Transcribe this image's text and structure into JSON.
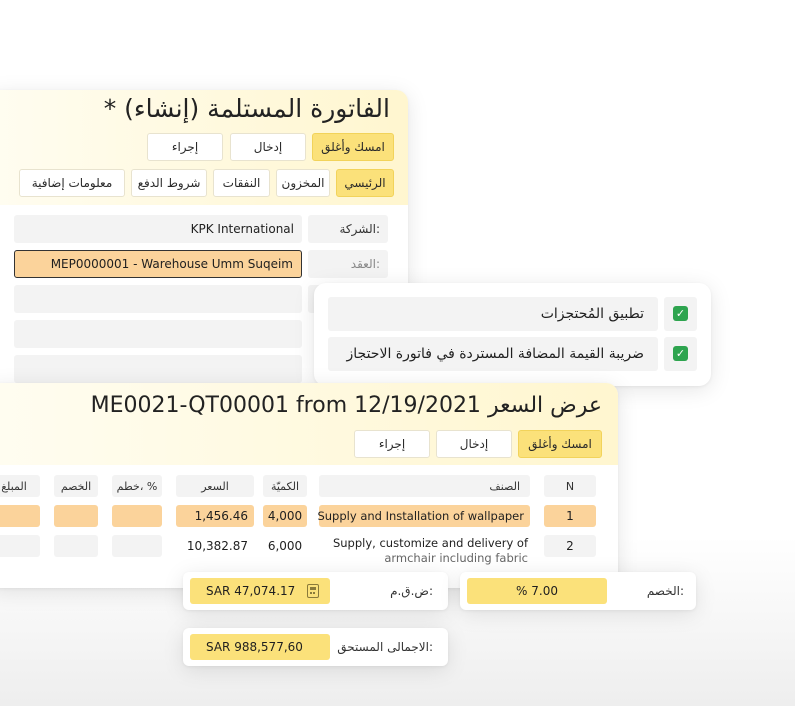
{
  "invoice": {
    "title": "الفاتورة المستلمة (إنشاء) *",
    "buttons": {
      "save_close": "امسك وأغلق",
      "enter": "إدخال",
      "action": "إجراء"
    },
    "tabs": [
      "الرئيسي",
      "المخزون",
      "النفقات",
      "شروط الدفع",
      "معلومات إضافية"
    ],
    "company_label": "الشركة:",
    "company_value": "KPK International",
    "contract_label": "العقد:",
    "contract_value": "MEP0000001 - Warehouse Umm Suqeim"
  },
  "options": {
    "items": [
      "تطبيق المُحتجزات",
      "ضريبة القيمة المضافة المستردة في فاتورة الاحتجاز"
    ]
  },
  "quote": {
    "title": "ME0021-QT00001 from 12/19/2021 عرض السعر",
    "buttons": {
      "save_close": "امسك وأغلق",
      "enter": "إدخال",
      "action": "إجراء"
    },
    "columns": {
      "n": "N",
      "item": "الصنف",
      "qty": "الكميّة",
      "price": "السعر",
      "disc_pct": "خطم، %",
      "discount": "الخصم",
      "amount": "المبلغ"
    },
    "rows": [
      {
        "n": "1",
        "item": "Supply and Installation of wallpaper",
        "qty": "4,000",
        "price": "1,456.46"
      },
      {
        "n": "2",
        "item_line1": "Supply, customize and delivery of",
        "item_line2": "armchair including fabric",
        "qty": "6,000",
        "price": "10,382.87"
      }
    ]
  },
  "totals": {
    "vat_label": "ض.ق.م:",
    "vat_value": "SAR 47,074.17",
    "discount_label": "الخصم:",
    "discount_value": "% 7.00",
    "total_label": "الاجمالى المستحق:",
    "total_value": "SAR 988,577,60"
  },
  "colors": {
    "accent": "#fbe17a",
    "highlight": "#fbd39b",
    "check": "#2ea44f"
  }
}
